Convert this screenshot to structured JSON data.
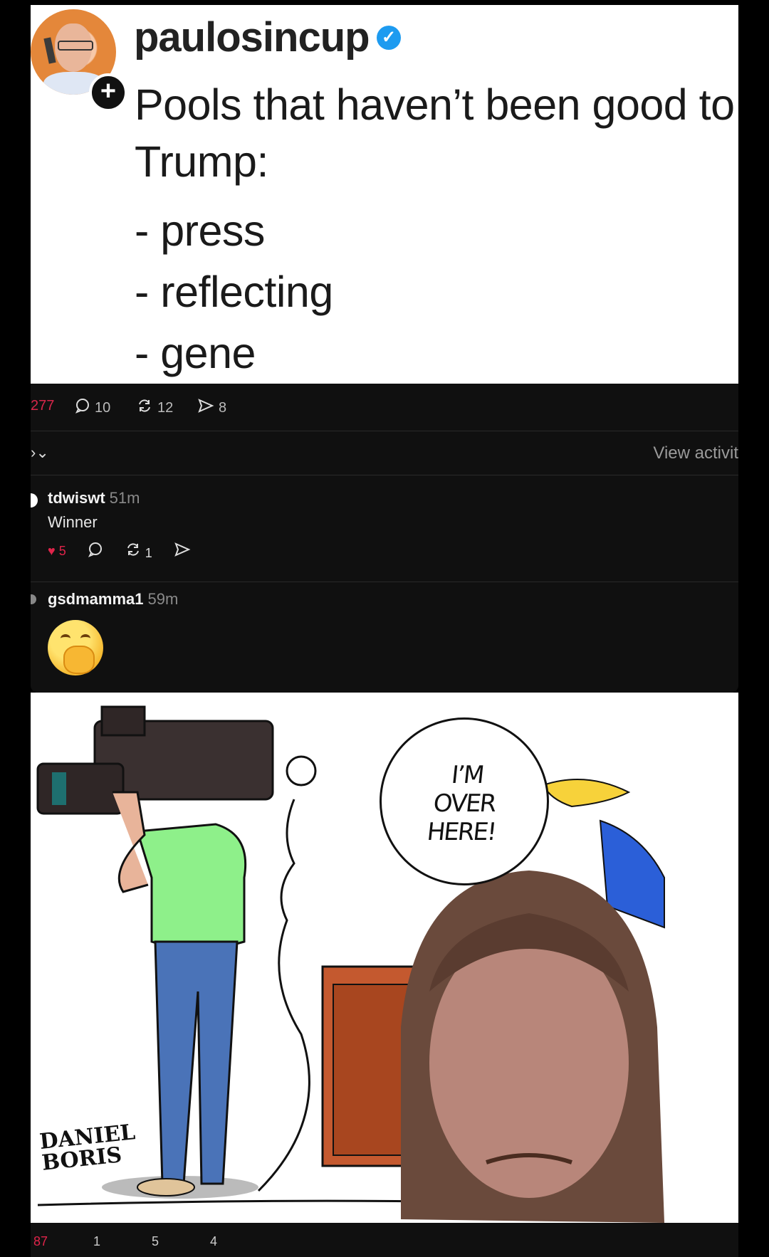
{
  "post": {
    "username": "paulosincup",
    "verified_mark": "✓",
    "follow_symbol": "+",
    "text_line1": "Pools that haven’t been good to",
    "text_line2": "Trump:",
    "list": [
      "- press",
      "- reflecting",
      "- gene"
    ]
  },
  "actions": {
    "likes": "277",
    "comments": "10",
    "reposts": "12",
    "shares": "8",
    "icons": [
      "heart-icon",
      "comment-icon",
      "repost-icon",
      "share-icon"
    ]
  },
  "thread_controls": {
    "sort_label": "›⌄",
    "view_activity": "View activit"
  },
  "replies": [
    {
      "user": "tdwiswt",
      "time": "51m",
      "text": "Winner",
      "likes": "5",
      "reposts": "1"
    },
    {
      "user": "gsdmamma1",
      "time": "59m",
      "emoji": "face-with-hand-over-mouth"
    }
  ],
  "cartoon": {
    "speech_bubble": [
      "I’M",
      "OVER",
      "HERE!"
    ],
    "signature": [
      "DANIEL",
      "BORIS"
    ]
  },
  "bottom_actions": {
    "likes": "87",
    "comments": "1",
    "reposts": "5",
    "shares": "4"
  },
  "colors": {
    "like_red": "#e0244a",
    "verified_blue": "#1d9bf0",
    "shirt_green": "#8ef08a",
    "jeans_blue": "#4a73b8",
    "desk_wood": "#c4592f"
  }
}
